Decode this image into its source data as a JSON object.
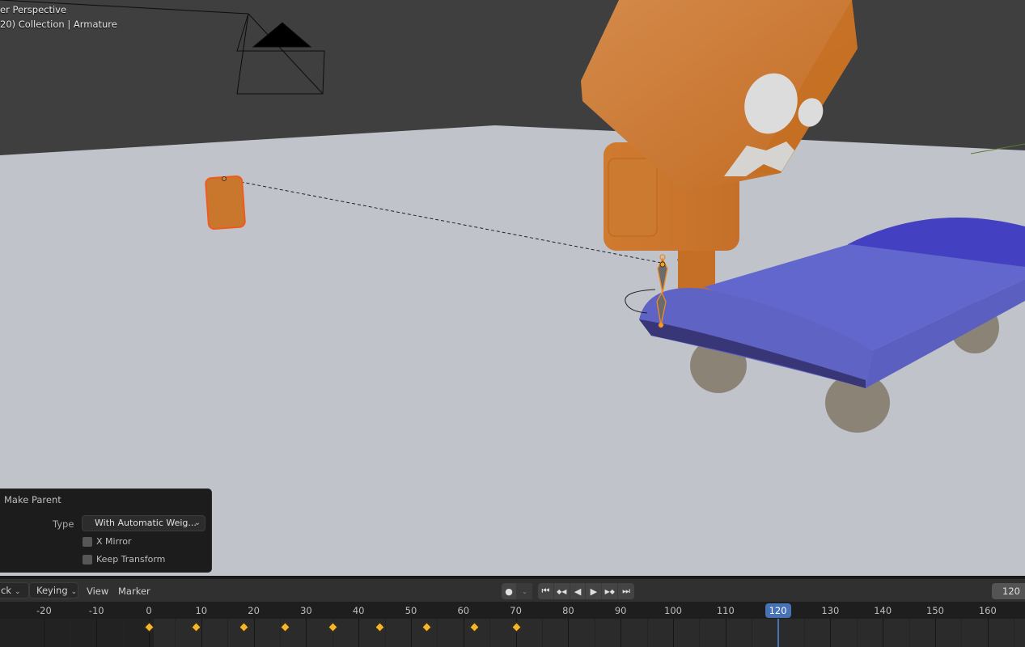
{
  "viewport": {
    "view_name": "er Perspective",
    "collection_info": "20) Collection | Armature",
    "colors": {
      "background": "#3f3f3f",
      "floor": "#c0c3ca",
      "character": "#cc7a2e",
      "vehicle": "#5e64c8",
      "wheels": "#8d8577",
      "selection_outline": "#f08a24",
      "bone": "#6a6a6a"
    },
    "objects": [
      {
        "name": "camera",
        "icon": "camera-wireframe"
      },
      {
        "name": "orange-block",
        "selected": true
      },
      {
        "name": "character-head"
      },
      {
        "name": "character-body"
      },
      {
        "name": "armature",
        "selected": true
      },
      {
        "name": "blue-vehicle"
      }
    ]
  },
  "operator_panel": {
    "title": "Make Parent",
    "type_label": "Type",
    "type_value": "With Automatic Weig...",
    "x_mirror_label": "X Mirror",
    "x_mirror_checked": false,
    "keep_transform_label": "Keep Transform",
    "keep_transform_checked": false
  },
  "timeline": {
    "playback_label": "ack",
    "keying_label": "Keying",
    "view_label": "View",
    "marker_label": "Marker",
    "record_icon": "record-icon",
    "record_dropdown_icon": "chevron-down-icon",
    "transport_buttons": [
      {
        "name": "jump-to-start",
        "glyph": "⏮"
      },
      {
        "name": "jump-to-prev-keyframe",
        "glyph": "◆◀"
      },
      {
        "name": "play-reverse",
        "glyph": "◀"
      },
      {
        "name": "play",
        "glyph": "▶"
      },
      {
        "name": "jump-to-next-keyframe",
        "glyph": "▶◆"
      },
      {
        "name": "jump-to-end",
        "glyph": "⏭"
      }
    ],
    "current_frame_field": "120",
    "current_frame": 120,
    "ruler_ticks": [
      -20,
      -10,
      0,
      10,
      20,
      30,
      40,
      50,
      60,
      70,
      80,
      90,
      100,
      110,
      120,
      130,
      140,
      150,
      160
    ],
    "keyframes": [
      0,
      9,
      18,
      26,
      35,
      44,
      53,
      62,
      70
    ],
    "accent_color": "#4772b3",
    "keyframe_color": "#f5b42a"
  }
}
